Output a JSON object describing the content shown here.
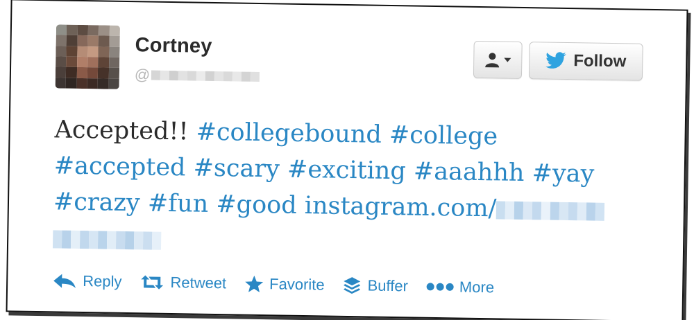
{
  "tweet": {
    "author_name": "Cortney",
    "handle_prefix": "@",
    "text_plain": "Accepted!!",
    "hashtags": [
      "#collegebound",
      "#college",
      "#accepted",
      "#scary",
      "#exciting",
      "#aaahhh",
      "#yay",
      "#crazy",
      "#fun",
      "#good"
    ],
    "link_text": "instagram.com/"
  },
  "buttons": {
    "follow_label": "Follow",
    "user_menu_icon": "person-icon"
  },
  "actions": [
    {
      "label": "Reply",
      "icon": "reply-icon"
    },
    {
      "label": "Retweet",
      "icon": "retweet-icon"
    },
    {
      "label": "Favorite",
      "icon": "star-icon"
    },
    {
      "label": "Buffer",
      "icon": "buffer-icon"
    },
    {
      "label": "More",
      "icon": "more-icon"
    }
  ],
  "colors": {
    "link": "#2a87c4",
    "twitter_bird": "#2fa3e0",
    "text": "#2b2b2b"
  }
}
